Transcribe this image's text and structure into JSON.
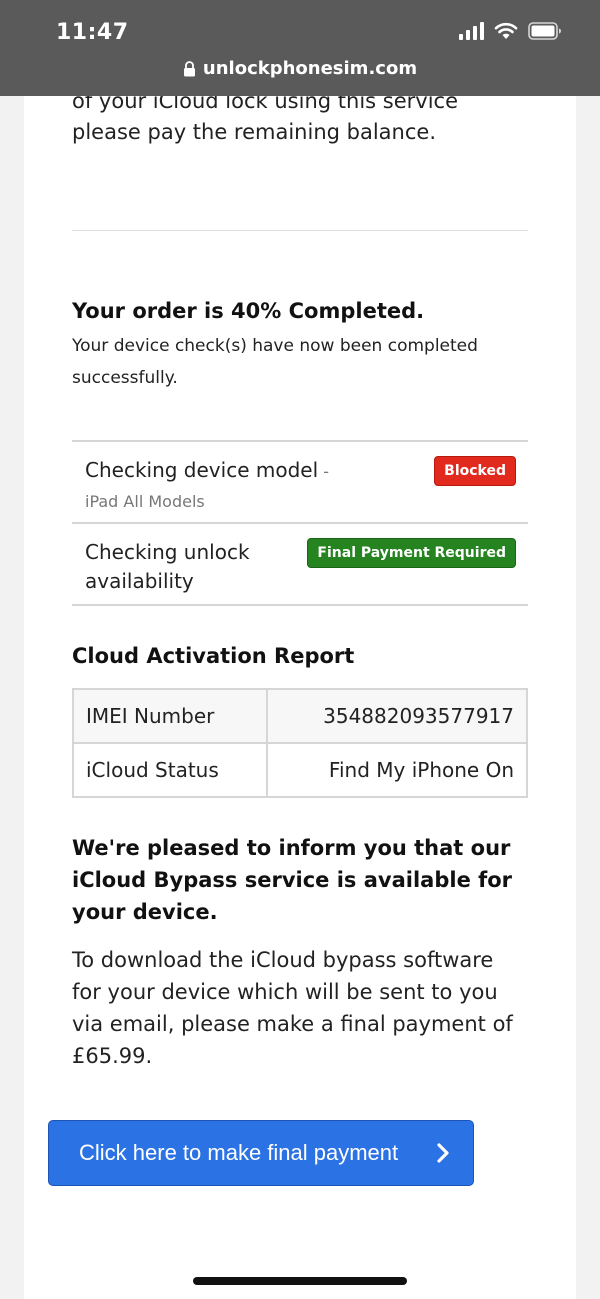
{
  "status_bar": {
    "time": "11:47"
  },
  "browser": {
    "url": "unlockphonesim.com"
  },
  "intro": {
    "text": "of your iCloud lock using this service please pay the remaining balance."
  },
  "progress": {
    "title": "Your order is 40% Completed.",
    "subtitle": "Your device check(s) have now been completed successfully.",
    "percent": 40
  },
  "checks": [
    {
      "label": "Checking device model",
      "detail": " - iPad All Models",
      "badge": "Blocked",
      "badge_color": "#e2291d"
    },
    {
      "label": "Checking unlock availability",
      "detail": "",
      "badge": "Final Payment Required",
      "badge_color": "#25841f"
    }
  ],
  "report": {
    "title": "Cloud Activation Report",
    "rows": [
      {
        "key": "IMEI Number",
        "value": "354882093577917"
      },
      {
        "key": "iCloud Status",
        "value": "Find My iPhone On"
      }
    ]
  },
  "message": {
    "headline": "We're pleased to inform you that our iCloud Bypass service is available for your device.",
    "body": "To download the iCloud bypass software for your device which will be sent to you via email, please make a final payment of £65.99."
  },
  "cta": {
    "label": "Click here to make final payment",
    "icon": "chevron-right-icon",
    "color": "#2b72e4"
  }
}
